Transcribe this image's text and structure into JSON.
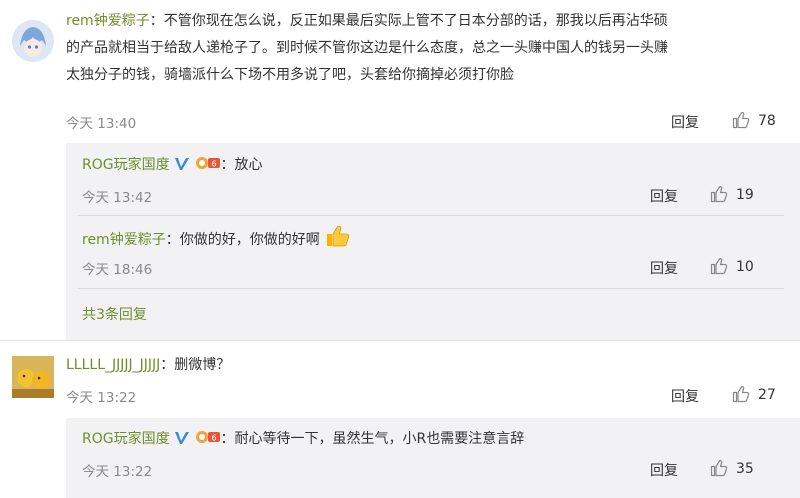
{
  "comments": [
    {
      "user": "rem钟爱粽子",
      "text_lines": [
        "：不管你现在怎么说，反正如果最后实际上管不了日本分部的话，那我以后再沾华硕",
        "的产品就相当于给敌人递枪子了。到时候不管你这边是什么态度，总之一头赚中国人的钱另一头赚",
        "太独分子的钱，骑墙派什么下场不用多说了吧，头套给你摘掉必须打你脸"
      ],
      "time": "今天 13:40",
      "reply_label": "回复",
      "likes": "78",
      "replies": [
        {
          "user": "ROG玩家国度",
          "text": "：放心",
          "time": "今天 13:42",
          "reply_label": "回复",
          "likes": "19"
        },
        {
          "user": "rem钟爱粽子",
          "text": "：你做的好，你做的好啊",
          "time": "今天 18:46",
          "reply_label": "回复",
          "likes": "10"
        }
      ],
      "more_replies": "共3条回复"
    },
    {
      "user": "LLLLL_JJJJJ_JJJJJ",
      "text_lines": [
        "：删微博？"
      ],
      "time": "今天 13:22",
      "reply_label": "回复",
      "likes": "27",
      "replies": [
        {
          "user": "ROG玩家国度",
          "text": "：耐心等待一下，虽然生气，小R也需要注意言辞",
          "time": "今天 13:22",
          "reply_label": "回复",
          "likes": "35"
        }
      ]
    }
  ],
  "colors": {
    "username": "#6f8f2a",
    "verified": "#3d8ad9",
    "background_reply": "#f2f2f5"
  }
}
